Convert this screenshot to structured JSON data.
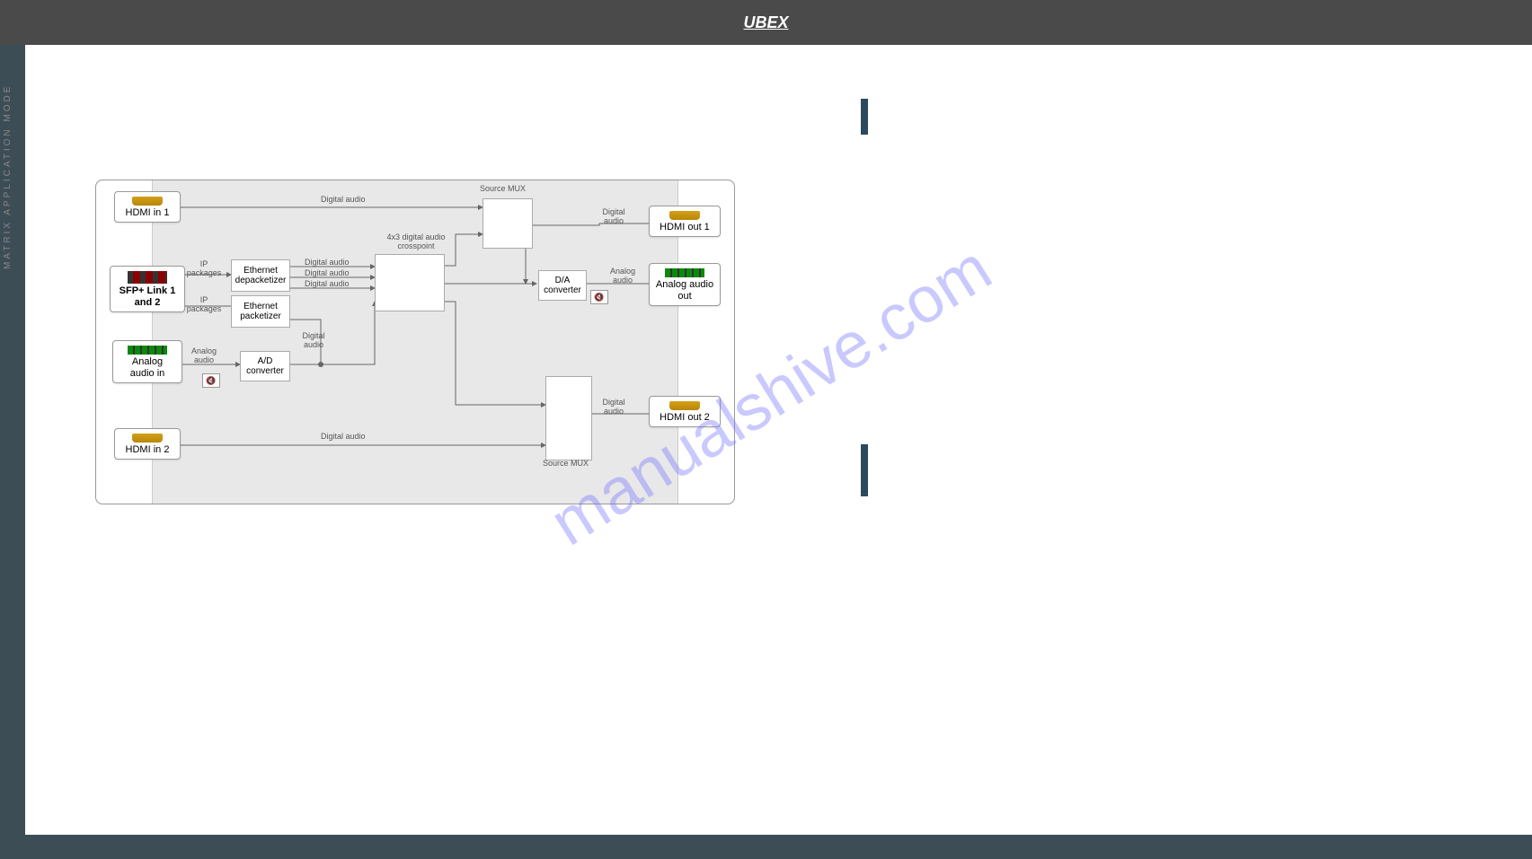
{
  "header": {
    "logo": "UBEX"
  },
  "sidebar": {
    "label": "MATRIX APPLICATION MODE"
  },
  "watermark": "manualshive.com",
  "diagram": {
    "ports": {
      "hdmi_in_1": "HDMI in 1",
      "hdmi_in_2": "HDMI in 2",
      "sfp_link": "SFP+ Link 1 and 2",
      "analog_in": "Analog audio in",
      "hdmi_out_1": "HDMI out 1",
      "hdmi_out_2": "HDMI out 2",
      "analog_out": "Analog audio out"
    },
    "blocks": {
      "eth_depacket": "Ethernet depacketizer",
      "eth_packet": "Ethernet packetizer",
      "ad_conv": "A/D converter",
      "da_conv": "D/A converter",
      "crosspoint": "4x3 digital audio crosspoint",
      "source_mux_top": "Source MUX",
      "source_mux_bottom": "Source MUX"
    },
    "labels": {
      "digital_audio": "Digital audio",
      "analog_audio": "Analog audio",
      "ip_packages": "IP packages"
    }
  }
}
